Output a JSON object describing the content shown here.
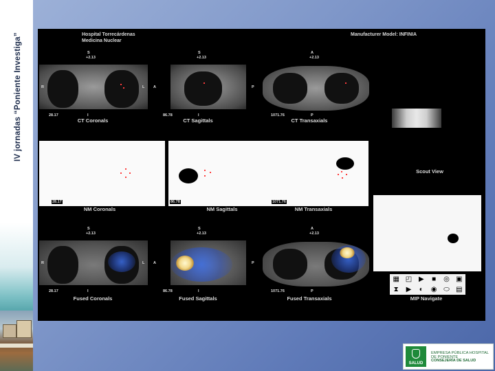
{
  "slide": {
    "side_title": "IV jornadas “Poniente Investiga”"
  },
  "viewer": {
    "hospital": "Hospital Torrecárdenas",
    "department": "Medicina Nuclear",
    "manufacturer": "Manufacturer Model: INFINIA",
    "captions": {
      "ct_coronal": "CT Coronals",
      "ct_sagittal": "CT Sagittals",
      "ct_transaxial": "CT Transaxials",
      "nm_coronal": "NM Coronals",
      "nm_sagittal": "NM Sagittals",
      "nm_transaxial": "NM Transaxials",
      "fused_coronal": "Fused Coronals",
      "fused_sagittal": "Fused Sagittals",
      "fused_transaxial": "Fused Transaxials",
      "scout": "Scout View",
      "mip": "MIP Navigate"
    },
    "orient": {
      "S": "S",
      "A": "A",
      "P": "P",
      "R": "R",
      "L": "L",
      "I": "I",
      "offset": "+2.13",
      "slice_cor": "28.17",
      "slice_sag": "86.78",
      "slice_tra": "1071.76"
    },
    "nav_icons": [
      "▦",
      "◰",
      "▶",
      "■",
      "◎",
      "▣",
      "⧗",
      "▶",
      "◐",
      "◉",
      "⬭",
      "▤"
    ]
  },
  "logo": {
    "emblem_text": "SALUD",
    "line1": "EMPRESA PÚBLICA HOSPITAL DE PONIENTE",
    "line2": "CONSEJERÍA DE SALUD"
  }
}
